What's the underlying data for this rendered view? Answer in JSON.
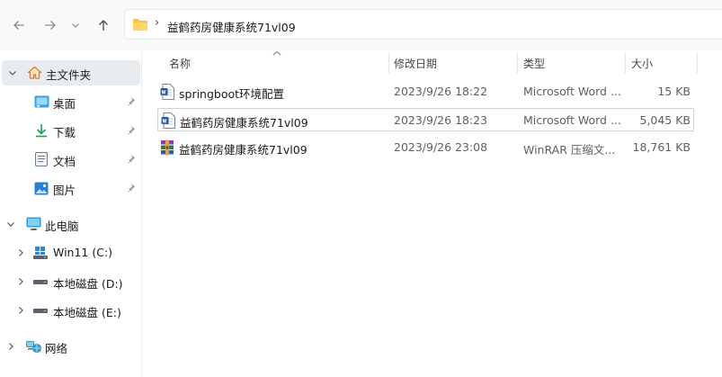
{
  "address": {
    "path": "益鹤药房健康系统71vl09"
  },
  "sidebar": {
    "home": "主文件夹",
    "quick": [
      {
        "label": "桌面",
        "icon": "desktop-icon"
      },
      {
        "label": "下载",
        "icon": "download-icon"
      },
      {
        "label": "文档",
        "icon": "document-icon"
      },
      {
        "label": "图片",
        "icon": "picture-icon"
      }
    ],
    "this_pc": "此电脑",
    "drives": [
      {
        "label": "Win11 (C:)",
        "icon": "windows-drive-icon"
      },
      {
        "label": "本地磁盘 (D:)",
        "icon": "disk-drive-icon"
      },
      {
        "label": "本地磁盘 (E:)",
        "icon": "disk-drive-icon"
      }
    ],
    "network": "网络"
  },
  "columns": {
    "name": "名称",
    "date": "修改日期",
    "type": "类型",
    "size": "大小"
  },
  "files": [
    {
      "name": "springboot环境配置",
      "date": "2023/9/26 18:22",
      "type": "Microsoft Word ...",
      "size": "15 KB",
      "icon": "word-file-icon"
    },
    {
      "name": "益鹤药房健康系统71vl09",
      "date": "2023/9/26 18:23",
      "type": "Microsoft Word ...",
      "size": "5,045 KB",
      "icon": "word-file-icon"
    },
    {
      "name": "益鹤药房健康系统71vl09",
      "date": "2023/9/26 23:08",
      "type": "WinRAR 压缩文...",
      "size": "18,761 KB",
      "icon": "winrar-archive-icon"
    }
  ],
  "colors": {
    "accent": "#0067c0",
    "folder": "#f6c343",
    "selected_bg": "#e9ecef"
  }
}
